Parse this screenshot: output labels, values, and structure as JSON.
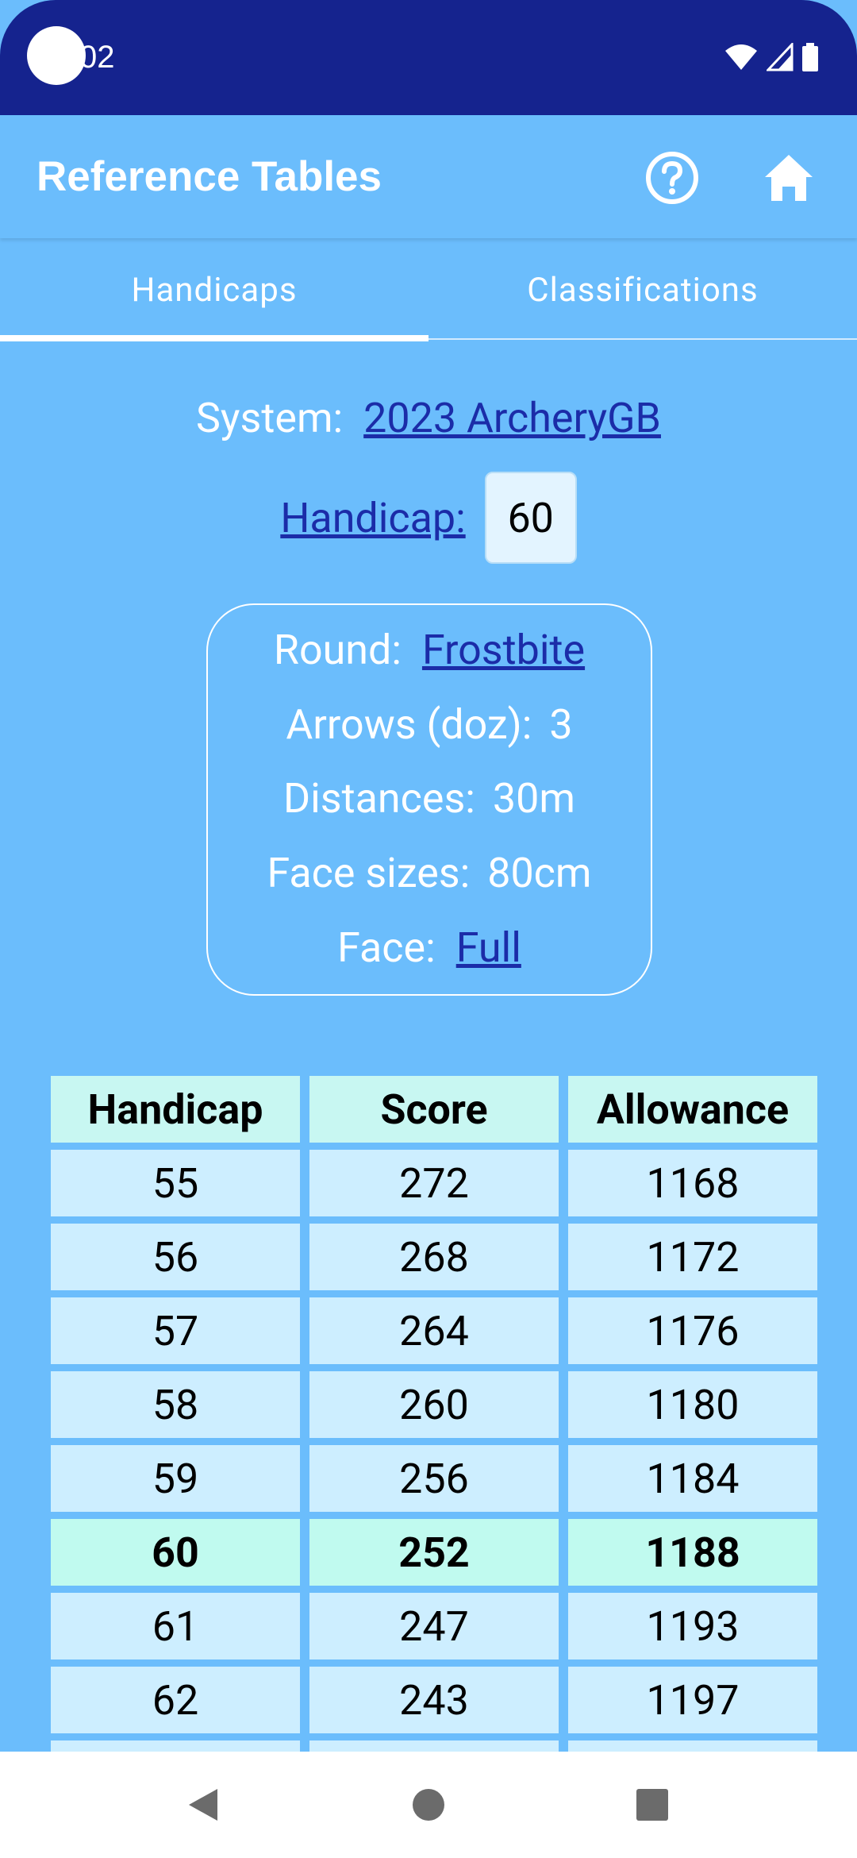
{
  "status_bar": {
    "time": "02"
  },
  "app_bar": {
    "title": "Reference Tables"
  },
  "tabs": [
    {
      "label": "Handicaps",
      "selected": true
    },
    {
      "label": "Classifications",
      "selected": false
    }
  ],
  "system": {
    "label": "System:",
    "value": "2023 ArcheryGB"
  },
  "handicap": {
    "label": "Handicap:",
    "value": "60"
  },
  "round_info": {
    "round_label": "Round:",
    "round_value": "Frostbite",
    "arrows_label": "Arrows (doz):",
    "arrows_value": "3",
    "distances_label": "Distances:",
    "distances_value": "30m",
    "face_sizes_label": "Face sizes:",
    "face_sizes_value": "80cm",
    "face_label": "Face:",
    "face_value": "Full"
  },
  "table": {
    "headers": [
      "Handicap",
      "Score",
      "Allowance"
    ],
    "rows": [
      [
        "55",
        "272",
        "1168"
      ],
      [
        "56",
        "268",
        "1172"
      ],
      [
        "57",
        "264",
        "1176"
      ],
      [
        "58",
        "260",
        "1180"
      ],
      [
        "59",
        "256",
        "1184"
      ],
      [
        "60",
        "252",
        "1188"
      ],
      [
        "61",
        "247",
        "1193"
      ],
      [
        "62",
        "243",
        "1197"
      ]
    ],
    "highlighted_row_index": 5
  },
  "colors": {
    "status_bar": "#15238E",
    "background": "#6BBDFC",
    "link": "#1B2CA8",
    "header_cell": "#C8F7F2",
    "cell": "#CDEEFF",
    "highlight_cell": "#C0FAEF"
  },
  "icons": {
    "help": "help-circle-icon",
    "home": "home-icon",
    "back": "back-triangle-icon",
    "home_nav": "home-circle-icon",
    "recents": "recents-square-icon"
  }
}
